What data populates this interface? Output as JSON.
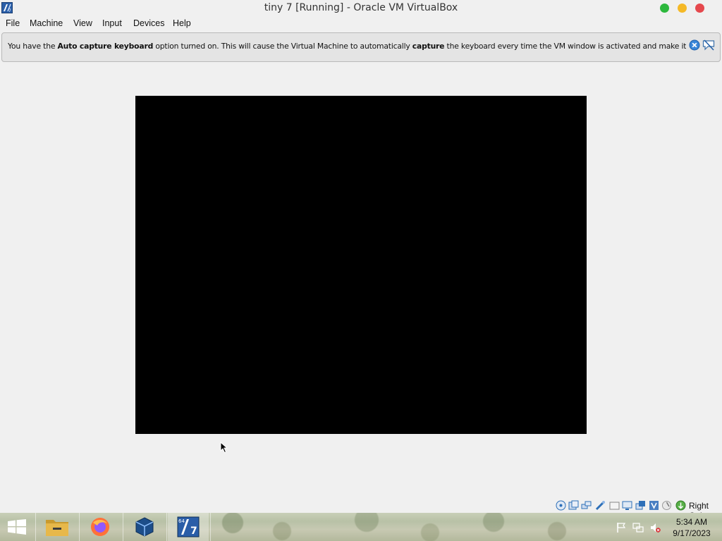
{
  "window": {
    "title": "tiny 7 [Running] - Oracle VM VirtualBox",
    "app_icon": "virtualbox-vm-icon",
    "controls": {
      "minimize_color": "#2db83d",
      "maximize_color": "#f5b927",
      "close_color": "#e5484d"
    }
  },
  "menu": {
    "items": [
      {
        "label": "File"
      },
      {
        "label": "Machine"
      },
      {
        "label": "View"
      },
      {
        "label": "Input"
      },
      {
        "label": "Devices"
      },
      {
        "label": "Help"
      }
    ]
  },
  "notification": {
    "text_1": "You have the ",
    "bold_1": "Auto capture keyboard",
    "text_2": " option turned on. This will cause the Virtual Machine to automatically ",
    "bold_2": "capture",
    "text_3": " the keyboard every time the VM window is activated and make it unavailable to",
    "close_icon": "close-circle-icon",
    "mute_icon": "do-not-show-again-icon"
  },
  "statusbar": {
    "icons": [
      "optical-drive-icon",
      "audio-icon",
      "network-icon",
      "usb-icon",
      "shared-folders-icon",
      "display-icon",
      "video-capture-icon",
      "virtualization-icon",
      "mouse-integration-icon",
      "keyboard-icon"
    ],
    "host_key": "Right Ctrl"
  },
  "taskbar": {
    "pinned": [
      "start-button",
      "file-explorer",
      "firefox",
      "virtualbox",
      "tiny7-vm"
    ],
    "tray_icons": [
      "action-center-flag-icon",
      "network-icon",
      "volume-muted-icon"
    ],
    "time": "5:34 AM",
    "date": "9/17/2023"
  }
}
